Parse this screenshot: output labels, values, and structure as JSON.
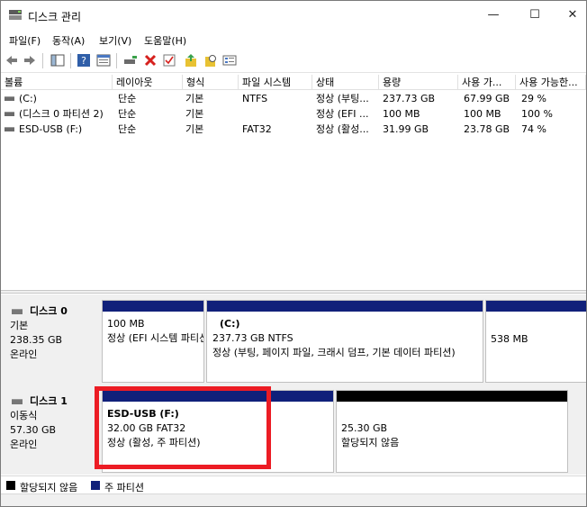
{
  "window": {
    "title": "디스크 관리",
    "minimize": "—",
    "maximize": "☐",
    "close": "✕"
  },
  "menu": [
    "파일(F)",
    "동작(A)",
    "보기(V)",
    "도움말(H)"
  ],
  "toolbar": {
    "icons": [
      "back-arrow-icon",
      "forward-arrow-icon",
      "console-tree-icon",
      "help-icon",
      "properties-icon",
      "connect-drive-icon",
      "delete-icon",
      "check-icon",
      "import-icon",
      "find-icon",
      "list-view-icon"
    ],
    "colors": {
      "delete": "#d6211e",
      "help": "#2f5ea8",
      "folder": "#e8c233"
    }
  },
  "volume_list": {
    "columns": [
      "볼륨",
      "레이아웃",
      "형식",
      "파일 시스템",
      "상태",
      "용량",
      "사용 가...",
      "사용 가능한..."
    ],
    "rows": [
      [
        "(C:)",
        "단순",
        "기본",
        "NTFS",
        "정상 (부팅...",
        "237.73 GB",
        "67.99 GB",
        "29 %"
      ],
      [
        "(디스크 0 파티션 2)",
        "단순",
        "기본",
        "",
        "정상 (EFI ...",
        "100 MB",
        "100 MB",
        "100 %"
      ],
      [
        "ESD-USB (F:)",
        "단순",
        "기본",
        "FAT32",
        "정상 (활성...",
        "31.99 GB",
        "23.78 GB",
        "74 %"
      ]
    ]
  },
  "disks": [
    {
      "name": "디스크 0",
      "type": "기본",
      "size": "238.35 GB",
      "status": "온라인",
      "partitions": [
        {
          "name": "",
          "detail": "100 MB",
          "status": "정상 (EFI 시스템 파티션)",
          "kind": "primary"
        },
        {
          "name": "(C:)",
          "detail": "237.73 GB NTFS",
          "status": "정상 (부팅, 페이지 파일, 크래시 덤프, 기본 데이터 파티션)",
          "kind": "primary"
        },
        {
          "name": "",
          "detail": "538 MB",
          "status": "",
          "kind": "primary"
        }
      ]
    },
    {
      "name": "디스크 1",
      "type": "이동식",
      "size": "57.30 GB",
      "status": "온라인",
      "partitions": [
        {
          "name": "ESD-USB  (F:)",
          "detail": "32.00 GB FAT32",
          "status": "정상 (활성, 주 파티션)",
          "kind": "primary"
        },
        {
          "name": "",
          "detail": "25.30 GB",
          "status": "할당되지 않음",
          "kind": "unallocated"
        }
      ]
    }
  ],
  "legend": [
    {
      "label": "할당되지 않음",
      "color": "#000000"
    },
    {
      "label": "주 파티션",
      "color": "#10207a"
    }
  ],
  "colors": {
    "primary_cap": "#10207a",
    "unallocated_cap": "#000000",
    "highlight": "#ec1c24"
  }
}
